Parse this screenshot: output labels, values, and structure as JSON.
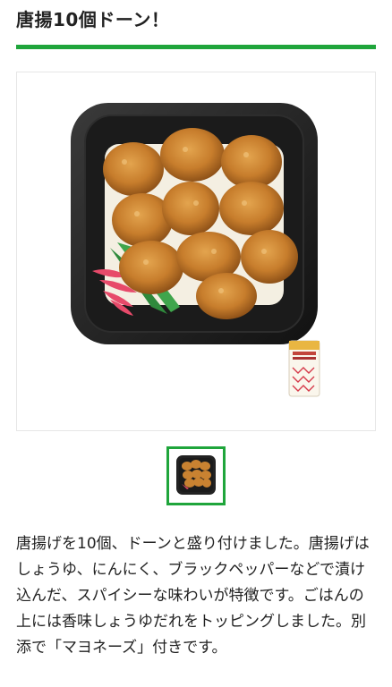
{
  "product": {
    "title": "唐揚10個ドーン！",
    "description": "唐揚げを10個、ドーンと盛り付けました。唐揚げはしょうゆ、にんにく、ブラックペッパーなどで漬け込んだ、スパイシーな味わいが特徴です。ごはんの上には香味しょうゆだれをトッピングしました。別添で「マヨネーズ」付きです。",
    "image": {
      "main": "karaage-bento-photo",
      "thumbnail": "karaage-bento-thumbnail"
    }
  },
  "colors": {
    "accent": "#1fa53b",
    "text": "#222222",
    "frame_border": "#e6e6e6"
  }
}
